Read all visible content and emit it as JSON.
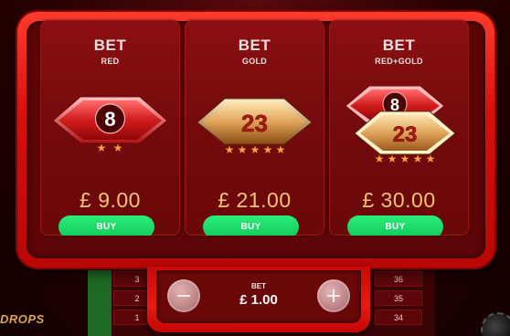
{
  "offers": [
    {
      "bet_word": "BET",
      "bet_type": "RED",
      "badges": [
        {
          "number": "8",
          "stars": 2,
          "style": "red"
        }
      ],
      "price": "£ 9.00",
      "buy_label": "BUY"
    },
    {
      "bet_word": "BET",
      "bet_type": "GOLD",
      "badges": [
        {
          "number": "23",
          "stars": 5,
          "style": "gold"
        }
      ],
      "price": "£ 21.00",
      "buy_label": "BUY"
    },
    {
      "bet_word": "BET",
      "bet_type": "RED+GOLD",
      "badges": [
        {
          "number": "8",
          "stars": 0,
          "style": "red"
        },
        {
          "number": "23",
          "stars": 5,
          "style": "gold"
        }
      ],
      "price": "£ 30.00",
      "buy_label": "BUY"
    }
  ],
  "stake": {
    "label": "BET",
    "value": "£ 1.00"
  },
  "background": {
    "logo_text": "DROPS",
    "table_numbers_left": [
      "3",
      "2",
      "1"
    ],
    "table_numbers_right": [
      "36",
      "35",
      "34"
    ]
  },
  "colors": {
    "frame_red": "#e0140f",
    "panel_dark": "#5e0507",
    "card": "#7a0b0d",
    "price_gold": "#f2c470",
    "buy_green": "#10c95a"
  }
}
